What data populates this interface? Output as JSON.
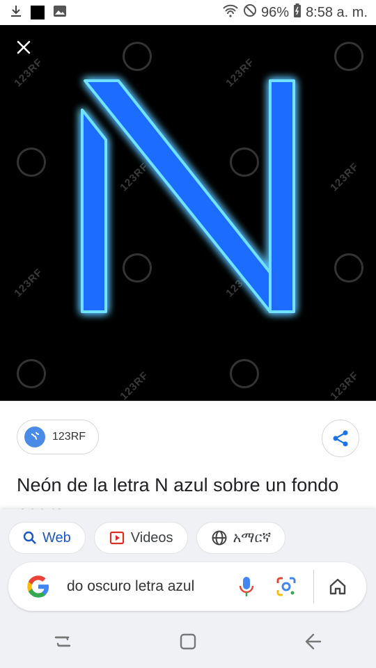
{
  "status_bar": {
    "battery": "96%",
    "time": "8:58 a. m."
  },
  "image_viewer": {
    "close_label": "close",
    "watermark_text": "123RF",
    "neon_letter": "N",
    "neon_color": "#1e6dff",
    "glow_color": "#6fe2ff"
  },
  "info_panel": {
    "source_name": "123RF",
    "title": "Neón de la letra N azul sobre un fondo negro"
  },
  "bottom_sheet": {
    "chips": [
      {
        "label": "Web",
        "icon": "search-icon"
      },
      {
        "label": "Videos",
        "icon": "video-icon"
      },
      {
        "label": "አማርኛ",
        "icon": "globe-icon"
      }
    ],
    "search_query": "do oscuro letra azul"
  },
  "colors": {
    "google_blue": "#4285F4",
    "google_red": "#EA4335",
    "google_yellow": "#FBBC05",
    "google_green": "#34A853"
  }
}
